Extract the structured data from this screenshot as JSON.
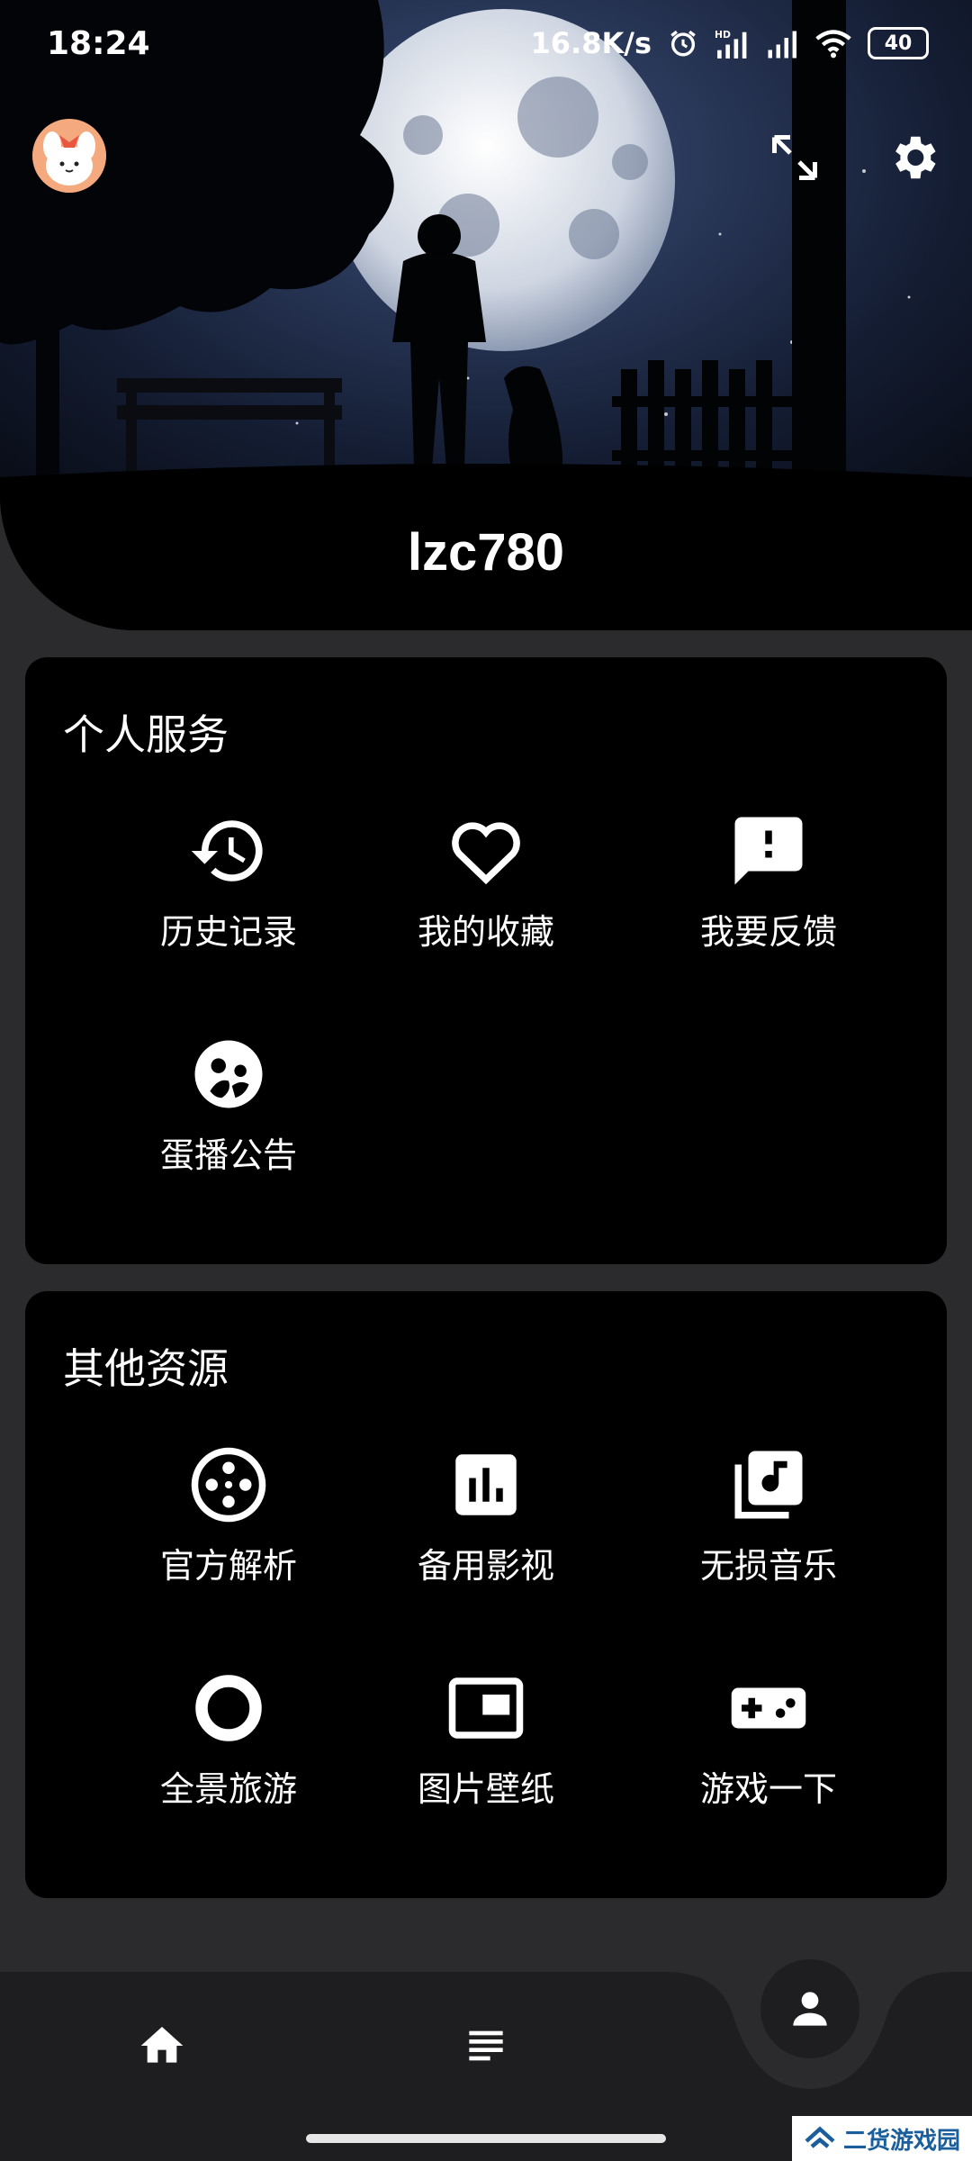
{
  "status_bar": {
    "time": "18:24",
    "network_speed": "16.8K/s",
    "battery": "40",
    "icons": [
      "alarm-icon",
      "hd-signal-icon",
      "signal-icon",
      "wifi-icon",
      "battery-icon"
    ]
  },
  "header": {
    "username": "lzc780",
    "icons": [
      "avatar",
      "fullscreen-icon",
      "settings-icon"
    ]
  },
  "personal_services": {
    "title": "个人服务",
    "items": [
      {
        "label": "历史记录",
        "icon": "history-icon"
      },
      {
        "label": "我的收藏",
        "icon": "heart-icon"
      },
      {
        "label": "我要反馈",
        "icon": "feedback-icon"
      },
      {
        "label": "蛋播公告",
        "icon": "announcement-icon"
      }
    ]
  },
  "other_resources": {
    "title": "其他资源",
    "items": [
      {
        "label": "官方解析",
        "icon": "film-reel-icon"
      },
      {
        "label": "备用影视",
        "icon": "bar-chart-icon"
      },
      {
        "label": "无损音乐",
        "icon": "music-library-icon"
      },
      {
        "label": "全景旅游",
        "icon": "ring-icon"
      },
      {
        "label": "图片壁纸",
        "icon": "picture-in-picture-icon"
      },
      {
        "label": "游戏一下",
        "icon": "gamepad-icon"
      }
    ]
  },
  "bottom_nav": {
    "items": [
      {
        "icon": "home-icon"
      },
      {
        "icon": "list-icon"
      },
      {
        "icon": "person-icon",
        "active": true
      }
    ]
  },
  "watermark": {
    "text": "二货游戏园"
  },
  "colors": {
    "background": "#2b2b2d",
    "card": "#000000",
    "text": "#ffffff",
    "nav": "#1e1e20"
  }
}
